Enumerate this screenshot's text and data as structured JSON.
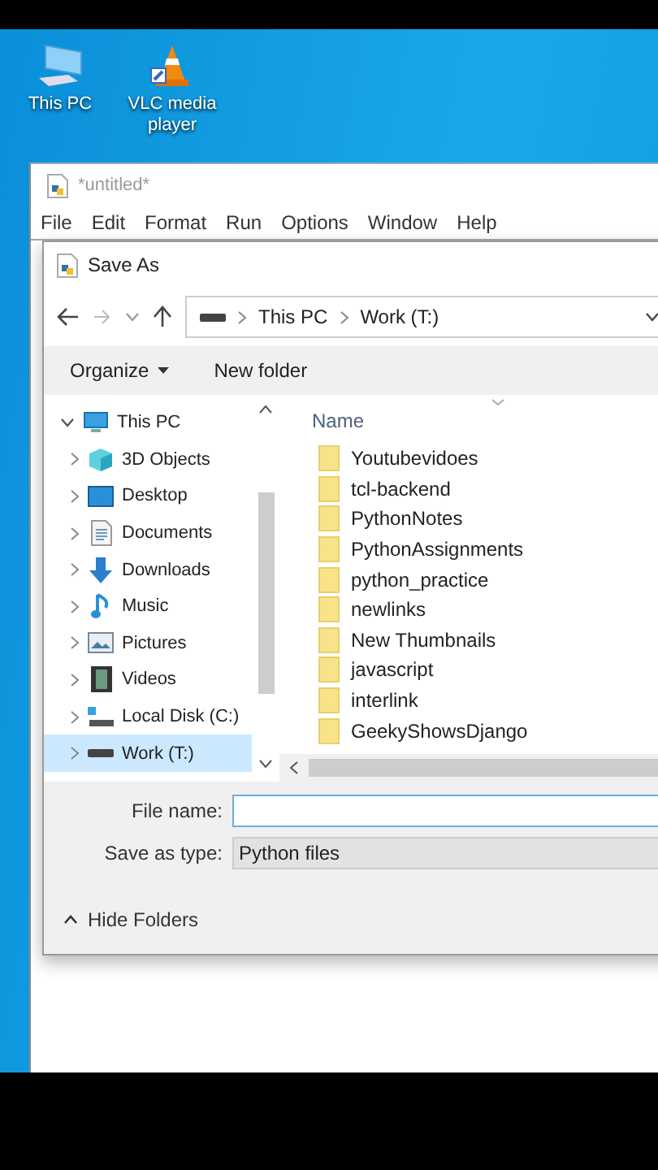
{
  "desktop_icons": [
    {
      "label": "This PC",
      "kind": "pc"
    },
    {
      "label": "VLC media player",
      "kind": "cone"
    }
  ],
  "editor_window": {
    "title": "*untitled*",
    "menu": [
      "File",
      "Edit",
      "Format",
      "Run",
      "Options",
      "Window",
      "Help"
    ]
  },
  "save_dialog": {
    "title": "Save As",
    "address": [
      "This PC",
      "Work (T:)"
    ],
    "toolbar": {
      "organize": "Organize",
      "new_folder": "New folder"
    },
    "tree": [
      {
        "label": "This PC",
        "kind": "pc",
        "expanded": true,
        "selected": false,
        "children": [
          {
            "label": "3D Objects",
            "kind": "objects",
            "selected": false
          },
          {
            "label": "Desktop",
            "kind": "desktop",
            "selected": false
          },
          {
            "label": "Documents",
            "kind": "documents",
            "selected": false
          },
          {
            "label": "Downloads",
            "kind": "downloads",
            "selected": false
          },
          {
            "label": "Music",
            "kind": "music",
            "selected": false
          },
          {
            "label": "Pictures",
            "kind": "pictures",
            "selected": false
          },
          {
            "label": "Videos",
            "kind": "videos",
            "selected": false
          },
          {
            "label": "Local Disk (C:)",
            "kind": "disk",
            "selected": false
          },
          {
            "label": "Work (T:)",
            "kind": "drive",
            "selected": true
          }
        ]
      }
    ],
    "file_list": {
      "column": "Name",
      "items": [
        "Youtubevidoes",
        "tcl-backend",
        "PythonNotes",
        "PythonAssignments",
        "python_practice",
        "newlinks",
        "New Thumbnails",
        "javascript",
        "interlink",
        "GeekyShowsDjango"
      ]
    },
    "file_name": {
      "label": "File name:"
    },
    "save_type": {
      "label": "Save as type:",
      "value": "Python files"
    },
    "hide_folders": "Hide Folders"
  }
}
